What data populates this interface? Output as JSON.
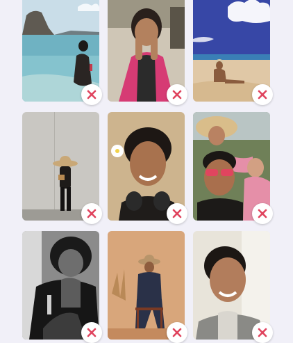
{
  "photo_grid": {
    "accent_color": "#e0445e",
    "remove_icon": "close-icon",
    "photos": [
      {
        "scene": "beach-rock-sea",
        "bg": "#7fb3c6"
      },
      {
        "scene": "woman-pink-jacket",
        "bg": "#c8bca8"
      },
      {
        "scene": "beach-blue-sky",
        "bg": "#3b4aa6"
      },
      {
        "scene": "woman-straw-hat-wall",
        "bg": "#c5c3be"
      },
      {
        "scene": "selfie-sand-headphones",
        "bg": "#d1b892"
      },
      {
        "scene": "group-selfie",
        "bg": "#8a9a6c"
      },
      {
        "scene": "black-white-portrait",
        "bg": "#5e5e5e"
      },
      {
        "scene": "studio-chair-hat",
        "bg": "#d2a077"
      },
      {
        "scene": "smiling-selfie",
        "bg": "#e6e2d8"
      }
    ]
  }
}
